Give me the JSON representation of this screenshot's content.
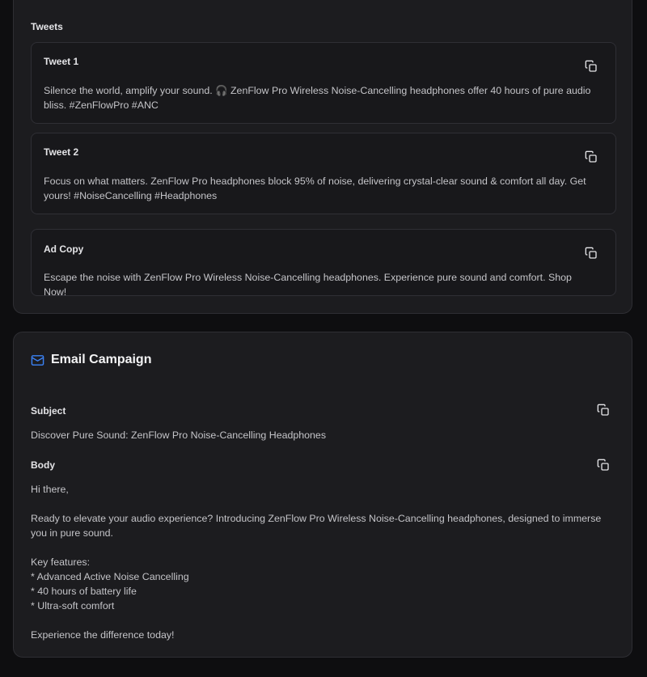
{
  "social": {
    "section_label": "Tweets",
    "tweets": [
      {
        "title": "Tweet 1",
        "text": "Silence the world, amplify your sound. 🎧 ZenFlow Pro Wireless Noise-Cancelling headphones offer 40 hours of pure audio bliss. #ZenFlowPro #ANC"
      },
      {
        "title": "Tweet 2",
        "text": "Focus on what matters. ZenFlow Pro headphones block 95% of noise, delivering crystal-clear sound & comfort all day. Get yours! #NoiseCancelling #Headphones"
      }
    ],
    "ad_copy": {
      "title": "Ad Copy",
      "text": "Escape the noise with ZenFlow Pro Wireless Noise-Cancelling headphones. Experience pure sound and comfort. Shop Now!"
    }
  },
  "email": {
    "heading": "Email Campaign",
    "subject_label": "Subject",
    "subject": "Discover Pure Sound: ZenFlow Pro Noise-Cancelling Headphones",
    "body_label": "Body",
    "body": "Hi there,\n\nReady to elevate your audio experience? Introducing ZenFlow Pro Wireless Noise-Cancelling headphones, designed to immerse you in pure sound.\n\nKey features:\n* Advanced Active Noise Cancelling\n* 40 hours of battery life\n* Ultra-soft comfort\n\nExperience the difference today!"
  },
  "colors": {
    "background": "#0e0e10",
    "card": "#1c1c1f",
    "accent_mail_icon": "#3b82f6"
  },
  "icons": {
    "copy": "copy-icon",
    "mail": "mail-icon"
  }
}
